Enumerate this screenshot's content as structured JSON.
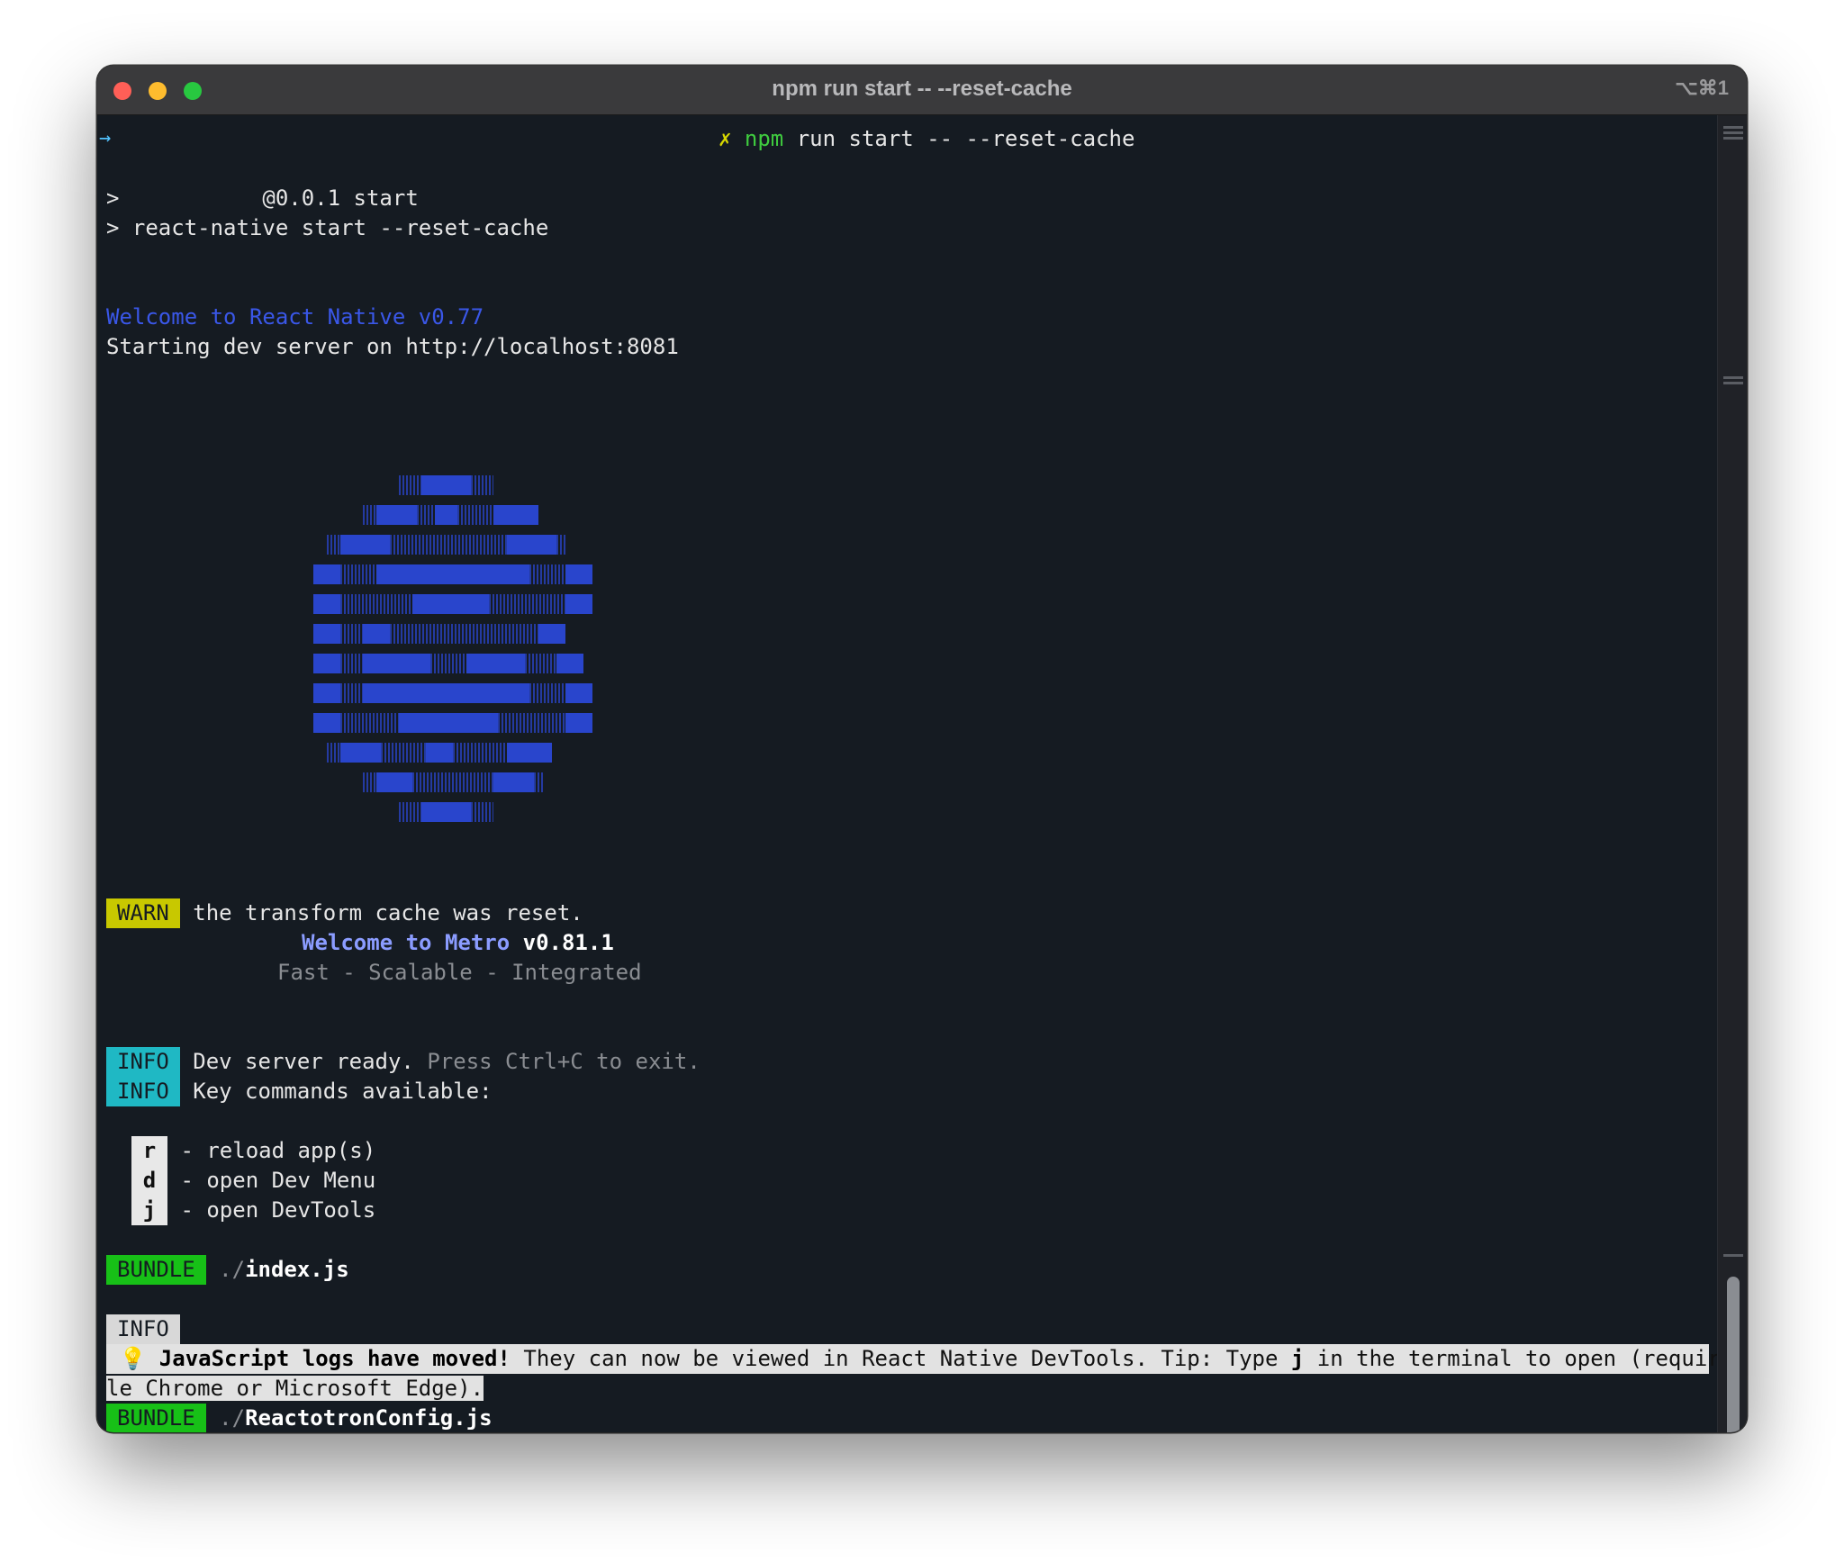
{
  "window": {
    "title": "npm run start -- --reset-cache",
    "shortcut": "⌥⌘1"
  },
  "prompt": {
    "arrow": "→",
    "x_mark": "✗",
    "npm": "npm",
    "command_rest": " run start -- --reset-cache"
  },
  "output": {
    "line1": ">           @0.0.1 start",
    "line2": "> react-native start --reset-cache",
    "welcome_rn": "Welcome to React Native v0.77",
    "dev_server": "Starting dev server on http://localhost:8081",
    "warn_badge": "WARN",
    "warn_text": " the transform cache was reset.",
    "metro_welcome": "Welcome to Metro",
    "metro_version": " v0.81.1",
    "metro_tagline": "Fast - Scalable - Integrated",
    "info_badge": "INFO",
    "info1_text": " Dev server ready.",
    "info1_dim": " Press Ctrl+C to exit.",
    "info2_text": " Key commands available:",
    "keys": [
      {
        "key": "r",
        "desc": " - reload app(s)"
      },
      {
        "key": "d",
        "desc": " - open Dev Menu"
      },
      {
        "key": "j",
        "desc": " - open DevTools"
      }
    ],
    "bundle_badge": "BUNDLE",
    "bundle1_dir": " ./",
    "bundle1_file": "index.js",
    "info3_badge": "INFO",
    "tip_icon": "💡",
    "tip_bold": "JavaScript logs have moved!",
    "tip_rest": " They can now be viewed in React Native DevTools. Tip: Type ",
    "tip_key": "j",
    "tip_rest2": " in the terminal to open (requires Goog",
    "tip_line2": "le Chrome or Microsoft Edge).",
    "bundle2_dir": " ./",
    "bundle2_file": "ReactotronConfig.js"
  },
  "colors": {
    "terminal_bg": "#151b22",
    "logo_blue": "#2945cc",
    "warn": "#c8c800",
    "info": "#1fb8c4",
    "bundle": "#17c017"
  }
}
